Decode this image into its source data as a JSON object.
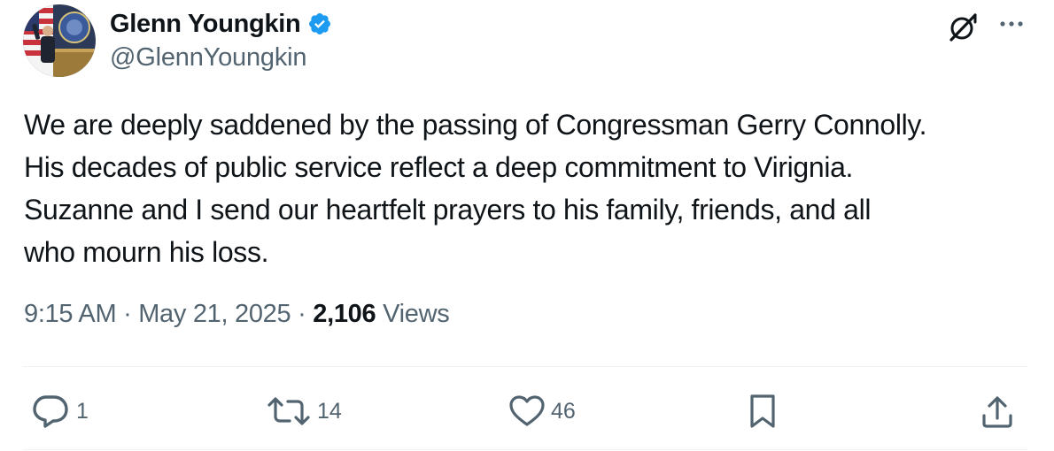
{
  "author": {
    "display_name": "Glenn Youngkin",
    "handle": "@GlennYoungkin",
    "verified": true,
    "avatar_icon": "avatar-photo"
  },
  "header_icons": {
    "grok": "grok-icon",
    "more": "more-icon"
  },
  "tweet": {
    "text": "We are deeply saddened by the passing of Congressman Gerry Connolly.\nHis decades of public service reflect a deep commitment to Virignia.\nSuzanne and I send our heartfelt prayers to his family, friends, and all\nwho mourn his loss."
  },
  "meta": {
    "time": "9:15 AM",
    "separator": "·",
    "date": "May 21, 2025",
    "views_count": "2,106",
    "views_label": "Views"
  },
  "actions": {
    "reply": {
      "icon": "reply-icon",
      "count": "1"
    },
    "repost": {
      "icon": "repost-icon",
      "count": "14"
    },
    "like": {
      "icon": "heart-icon",
      "count": "46"
    },
    "bookmark": {
      "icon": "bookmark-icon"
    },
    "share": {
      "icon": "share-icon"
    }
  },
  "colors": {
    "text_primary": "#0f1419",
    "text_secondary": "#536471",
    "verified_badge": "#1d9bf0",
    "divider": "#eff3f4"
  }
}
